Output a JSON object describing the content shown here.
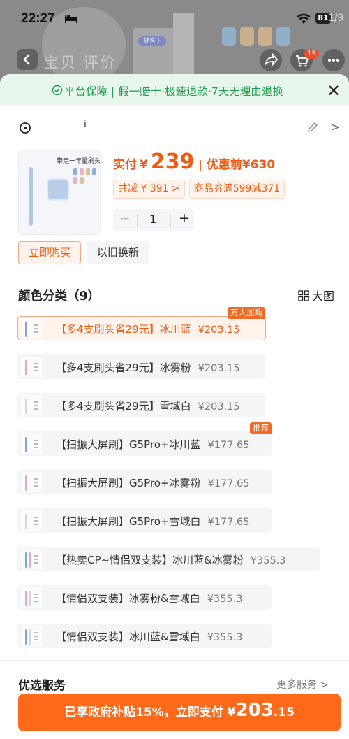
{
  "status_bar": {
    "time": "22:27",
    "battery": "81",
    "page_counter": "1/9"
  },
  "background": {
    "faint_title": "宝贝 评价",
    "cloud_badge": "舒客+",
    "cart_count": "19"
  },
  "guarantee": {
    "text": "平台保障 | 假一赔十·极速退款·7天无理由退换"
  },
  "address": {
    "text": "i"
  },
  "product": {
    "thumb_label": "带走一年量刷头",
    "price_label": "实付",
    "currency": "¥",
    "price": "239",
    "original_label": "优惠前",
    "original_price": "¥630",
    "tags": [
      "共减 ¥ 391 >",
      "商品券满599减371"
    ],
    "quantity": "1"
  },
  "purchase_modes": [
    "立即购买",
    "以旧换新"
  ],
  "color_section": {
    "title": "颜色分类（9）",
    "big_view": "大图"
  },
  "options": [
    {
      "name": "【多4支刷头省29元】冰川蓝",
      "price": "¥203.15",
      "tag": "万人加购",
      "selected": true
    },
    {
      "name": "【多4支刷头省29元】冰雾粉",
      "price": "¥203.15",
      "tag": "",
      "selected": false
    },
    {
      "name": "【多4支刷头省29元】雪域白",
      "price": "¥203.15",
      "tag": "",
      "selected": false
    },
    {
      "name": "【扫振大屏刷】G5Pro+冰川蓝",
      "price": "¥177.65",
      "tag": "推荐",
      "selected": false
    },
    {
      "name": "【扫振大屏刷】G5Pro+冰雾粉",
      "price": "¥177.65",
      "tag": "",
      "selected": false
    },
    {
      "name": "【扫振大屏刷】G5Pro+雪域白",
      "price": "¥177.65",
      "tag": "",
      "selected": false
    },
    {
      "name": "【热卖CP~情侣双支装】冰川蓝&冰雾粉",
      "price": "¥355.3",
      "tag": "",
      "selected": false
    },
    {
      "name": "【情侣双支装】冰雾粉&雪域白",
      "price": "¥355.3",
      "tag": "",
      "selected": false
    },
    {
      "name": "【情侣双支装】冰川蓝&雪域白",
      "price": "¥355.3",
      "tag": "",
      "selected": false
    }
  ],
  "services": {
    "title": "优选服务",
    "more": "更多服务 >"
  },
  "cta": {
    "text": "已享政府补贴15%，立即支付 ¥",
    "amount": "203",
    "decimal": ".15"
  },
  "colors": {
    "accent": "#ef5a10",
    "cta_bg": "#ff6a1a",
    "guarantee_green": "#1d9d4e"
  }
}
